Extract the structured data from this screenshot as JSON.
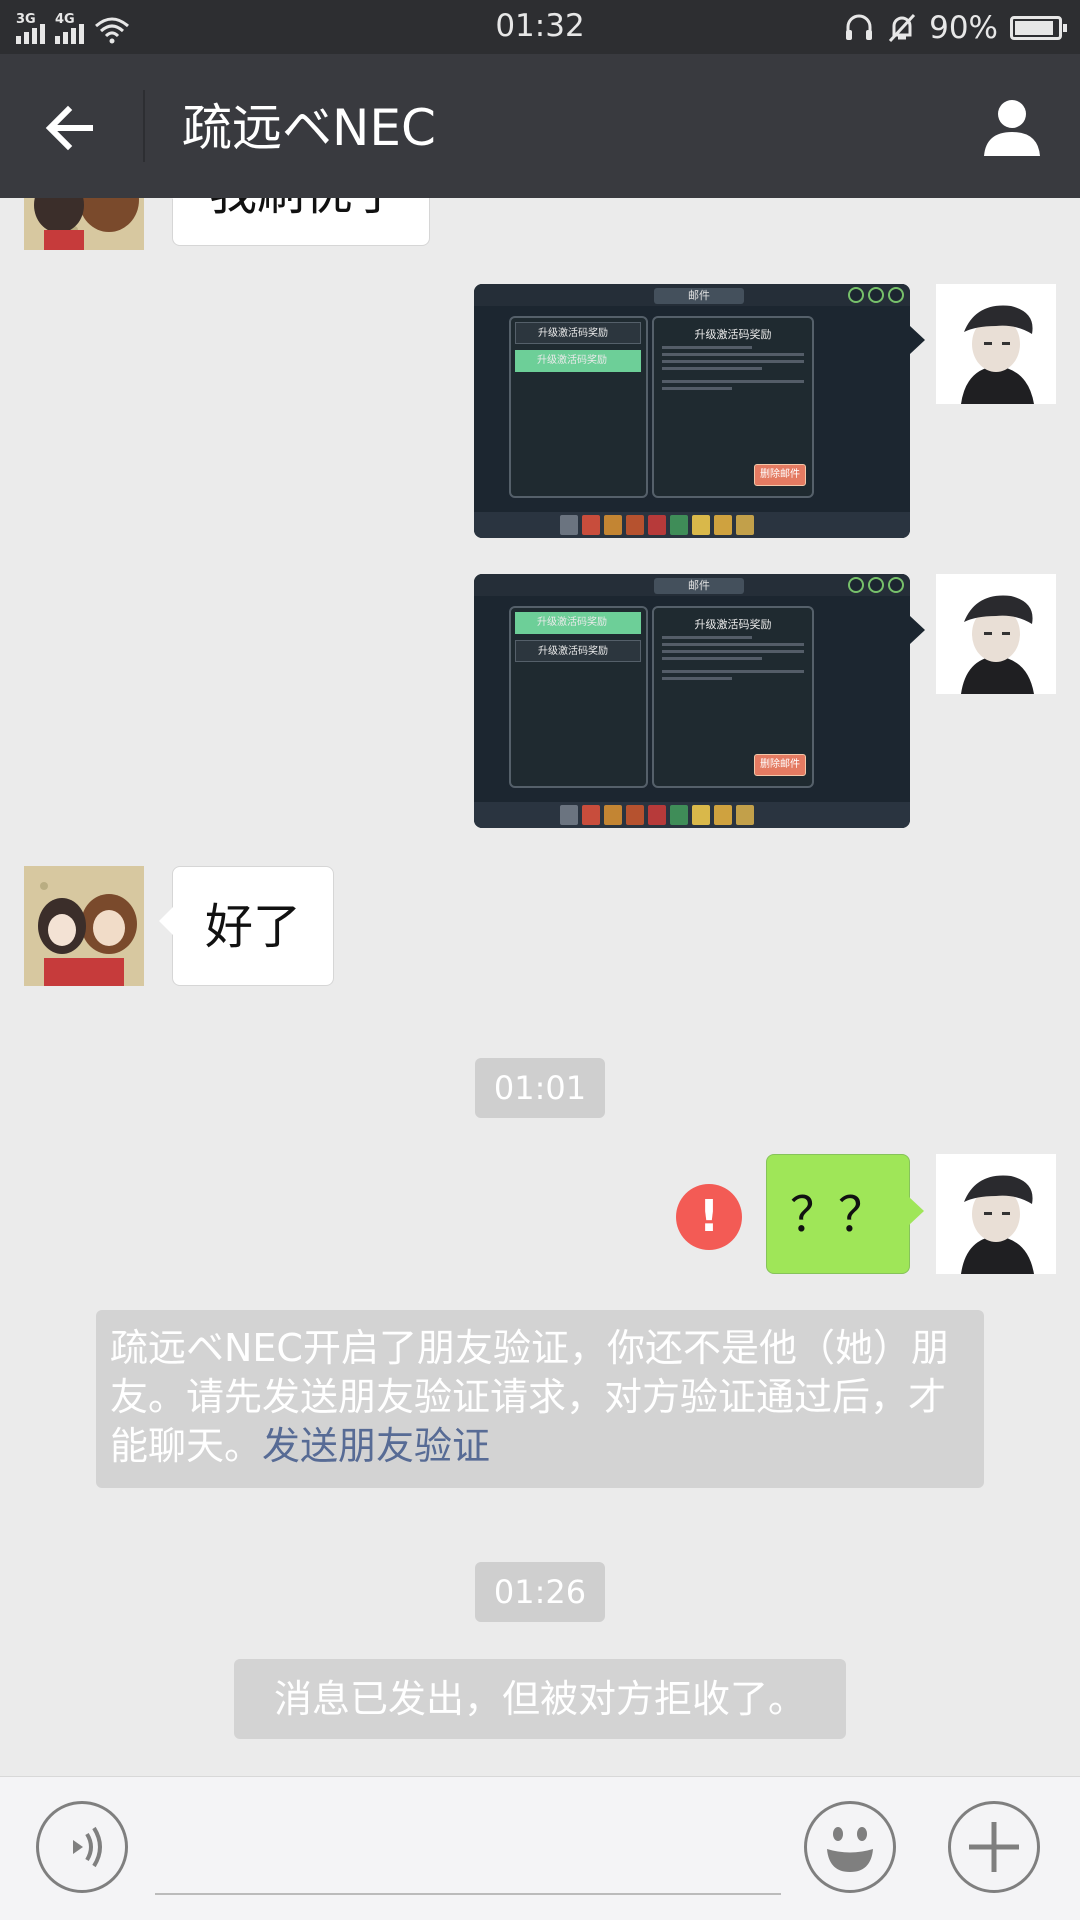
{
  "status_bar": {
    "network_1": "3G",
    "network_2": "4G",
    "time": "01:32",
    "battery_percent": "90%",
    "battery_level": 0.9
  },
  "header": {
    "title": "疏远ベNEC"
  },
  "messages": {
    "partial_text": "我刷优了",
    "screenshot_1": {
      "title": "邮件",
      "list_items": [
        "升级激活码奖励",
        "升级激活码奖励"
      ],
      "reward_title": "升级激活码奖励",
      "delete_button": "删除邮件"
    },
    "screenshot_2": {
      "title": "邮件",
      "list_items": [
        "升级激活码奖励",
        "升级激活码奖励"
      ],
      "reward_title": "升级激活码奖励",
      "delete_button": "删除邮件"
    },
    "reply_text": "好了",
    "time_1": "01:01",
    "question_text": "？？",
    "failed_icon": "!",
    "verify_notice": {
      "text": "疏远ベNEC开启了朋友验证，你还不是他（她）朋友。请先发送朋友验证请求，对方验证通过后，才能聊天。",
      "link": "发送朋友验证"
    },
    "time_2": "01:26",
    "rejected_notice": "消息已发出，但被对方拒收了。"
  },
  "input_bar": {
    "voice_icon": "voice-icon",
    "emoji_icon": "emoji-icon",
    "plus_icon": "plus-icon"
  },
  "colors": {
    "header_bg": "#393a3f",
    "status_bg": "#2d2e31",
    "chat_bg": "#ebebeb",
    "my_bubble": "#9fe658",
    "error_red": "#f35b55",
    "link_blue": "#576b95"
  }
}
